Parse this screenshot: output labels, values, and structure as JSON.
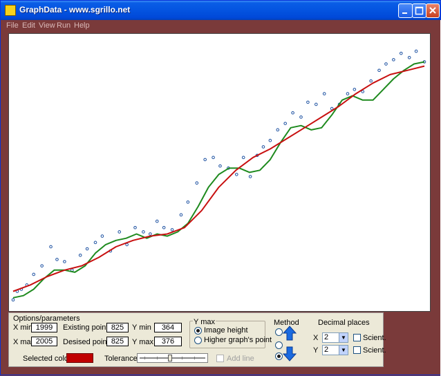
{
  "window": {
    "title": "GraphData - www.sgrillo.net"
  },
  "menu": [
    "File",
    "Edit",
    "View",
    "Run",
    "Help"
  ],
  "colors": {
    "points": "#1a4fa0",
    "smooth_curve": "#1e8a1e",
    "trend_curve": "#c81010",
    "selected": "#c00000"
  },
  "chart_data": {
    "type": "scatter",
    "title": "",
    "xlabel": "",
    "ylabel": "",
    "xlim": [
      1999,
      2005
    ],
    "ylim": [
      364,
      376
    ],
    "grid": false,
    "series": [
      {
        "kind": "points",
        "x": [
          1999.0,
          1999.06,
          1999.12,
          1999.2,
          1999.3,
          1999.42,
          1999.55,
          1999.64,
          1999.75,
          1999.86,
          1999.98,
          2000.08,
          2000.2,
          2000.3,
          2000.42,
          2000.55,
          2000.66,
          2000.78,
          2000.9,
          2001.0,
          2001.1,
          2001.2,
          2001.32,
          2001.45,
          2001.55,
          2001.68,
          2001.8,
          2001.92,
          2002.02,
          2002.14,
          2002.26,
          2002.36,
          2002.46,
          2002.56,
          2002.65,
          2002.75,
          2002.86,
          2002.97,
          2003.08,
          2003.2,
          2003.3,
          2003.42,
          2003.54,
          2003.65,
          2003.76,
          2003.88,
          2003.98,
          2004.1,
          2004.22,
          2004.34,
          2004.44,
          2004.55,
          2004.66,
          2004.78,
          2004.88,
          2005.0
        ],
        "y": [
          364.2,
          364.6,
          364.7,
          364.9,
          365.4,
          365.8,
          366.7,
          366.1,
          366.0,
          365.6,
          366.3,
          366.6,
          366.9,
          367.2,
          366.5,
          367.4,
          366.8,
          367.6,
          367.4,
          367.3,
          367.9,
          367.6,
          367.5,
          368.2,
          368.8,
          369.7,
          370.8,
          370.9,
          370.5,
          370.4,
          370.1,
          370.9,
          370.0,
          371.0,
          371.4,
          371.7,
          372.2,
          372.5,
          373.0,
          372.8,
          373.5,
          373.4,
          373.9,
          373.2,
          373.4,
          373.9,
          374.1,
          374.0,
          374.5,
          375.0,
          375.3,
          375.5,
          375.8,
          375.6,
          375.9,
          375.4
        ]
      },
      {
        "kind": "smooth",
        "x": [
          1999.0,
          1999.15,
          1999.3,
          1999.45,
          1999.6,
          1999.75,
          1999.9,
          2000.05,
          2000.2,
          2000.35,
          2000.5,
          2000.65,
          2000.8,
          2000.95,
          2001.1,
          2001.25,
          2001.4,
          2001.55,
          2001.7,
          2001.85,
          2002.0,
          2002.15,
          2002.3,
          2002.45,
          2002.6,
          2002.75,
          2002.9,
          2003.05,
          2003.2,
          2003.35,
          2003.5,
          2003.65,
          2003.8,
          2003.95,
          2004.1,
          2004.25,
          2004.4,
          2004.55,
          2004.7,
          2004.85,
          2005.0
        ],
        "y": [
          364.3,
          364.4,
          364.7,
          365.2,
          365.6,
          365.6,
          365.5,
          365.8,
          366.4,
          366.8,
          367.0,
          367.1,
          367.3,
          367.1,
          367.3,
          367.2,
          367.4,
          367.8,
          368.6,
          369.5,
          370.1,
          370.4,
          370.4,
          370.2,
          370.3,
          370.8,
          371.6,
          372.3,
          372.4,
          372.2,
          372.3,
          372.9,
          373.6,
          373.8,
          373.6,
          373.6,
          374.1,
          374.6,
          375.0,
          375.3,
          375.4
        ]
      },
      {
        "kind": "trend",
        "x": [
          1999.0,
          1999.25,
          1999.5,
          1999.75,
          2000.0,
          2000.25,
          2000.5,
          2000.75,
          2001.0,
          2001.25,
          2001.5,
          2001.75,
          2002.0,
          2002.25,
          2002.5,
          2002.75,
          2003.0,
          2003.25,
          2003.5,
          2003.75,
          2004.0,
          2004.25,
          2004.5,
          2004.75,
          2005.0
        ],
        "y": [
          364.6,
          364.9,
          365.3,
          365.6,
          365.8,
          366.2,
          366.7,
          367.0,
          367.2,
          367.3,
          367.6,
          368.4,
          369.5,
          370.3,
          370.9,
          371.3,
          371.8,
          372.3,
          372.8,
          373.3,
          373.9,
          374.4,
          374.8,
          375.0,
          375.2
        ]
      }
    ]
  },
  "options": {
    "group_title": "Options/parameters",
    "xmin_label": "X min",
    "xmin_value": "1999",
    "xmax_label": "X max",
    "xmax_value": "2005",
    "existing_label": "Existing points X",
    "existing_x": "825",
    "desired_label": "Desised points X",
    "desired_x": "825",
    "ymin_label": "Y min",
    "ymin_value": "364",
    "ymax_label": "Y max",
    "ymax_value": "376",
    "selected_color_label": "Selected color",
    "tolerance_label": "Tolerance",
    "tolerance_level": 0.45,
    "add_line_label": "Add line"
  },
  "ymax_group": {
    "title": "Y max",
    "option_image": "Image height",
    "option_higher": "Higher graph's point"
  },
  "method": {
    "title": "Method"
  },
  "decimals": {
    "title": "Decimal places",
    "x_label": "X",
    "x_value": "2",
    "y_label": "Y",
    "y_value": "2",
    "scient_label": "Scient."
  }
}
